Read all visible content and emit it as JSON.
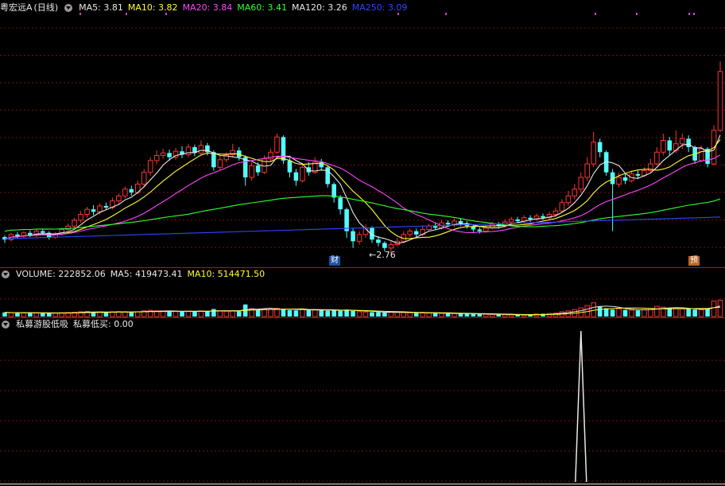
{
  "price_panel": {
    "stock_name": "粤宏远A",
    "period": "(日线)",
    "ma5": "MA5: 3.81",
    "ma10": "MA10: 3.82",
    "ma20": "MA20: 3.84",
    "ma60": "MA60: 3.41",
    "ma120": "MA120: 3.26",
    "ma250": "MA250: 3.09",
    "low_marker": "←2.76",
    "event_cai": "财",
    "event_yu": "预"
  },
  "volume_panel": {
    "volume": "VOLUME: 222852.06",
    "ma5": "MA5: 419473.41",
    "ma10": "MA10: 514471.50"
  },
  "indicator_panel": {
    "name": "私募游股低吸",
    "output": "私募低买: 0.00"
  },
  "colors": {
    "up": "#ff3333",
    "down": "#54fcfc",
    "ma5": "#e8e8e8",
    "ma10": "#ffff33",
    "ma20": "#ff44ff",
    "ma60": "#33ff33",
    "ma250": "#3344ff",
    "grid": "#7a1010"
  },
  "chart_data": [
    {
      "type": "candlestick",
      "title": "粤宏远A (日线)",
      "ylim": [
        2.6,
        5.6
      ],
      "low_annotation": 2.76,
      "candles": [
        [
          2.95,
          2.92,
          2.97,
          2.88
        ],
        [
          2.92,
          2.98,
          3.0,
          2.9
        ],
        [
          2.98,
          2.96,
          3.01,
          2.93
        ],
        [
          2.96,
          3.0,
          3.02,
          2.94
        ],
        [
          3.0,
          2.97,
          3.03,
          2.95
        ],
        [
          2.97,
          3.02,
          3.04,
          2.95
        ],
        [
          3.02,
          3.0,
          3.05,
          2.97
        ],
        [
          3.0,
          2.95,
          3.02,
          2.92
        ],
        [
          2.95,
          2.99,
          3.01,
          2.93
        ],
        [
          2.99,
          3.04,
          3.06,
          2.97
        ],
        [
          3.04,
          3.08,
          3.11,
          3.02
        ],
        [
          3.08,
          3.15,
          3.18,
          3.06
        ],
        [
          3.15,
          3.22,
          3.26,
          3.12
        ],
        [
          3.22,
          3.28,
          3.31,
          3.18
        ],
        [
          3.28,
          3.25,
          3.33,
          3.21
        ],
        [
          3.25,
          3.32,
          3.35,
          3.22
        ],
        [
          3.32,
          3.3,
          3.36,
          3.27
        ],
        [
          3.3,
          3.38,
          3.42,
          3.28
        ],
        [
          3.38,
          3.44,
          3.47,
          3.35
        ],
        [
          3.44,
          3.52,
          3.55,
          3.41
        ],
        [
          3.52,
          3.48,
          3.56,
          3.44
        ],
        [
          3.48,
          3.58,
          3.62,
          3.46
        ],
        [
          3.58,
          3.72,
          3.76,
          3.55
        ],
        [
          3.72,
          3.86,
          3.9,
          3.68
        ],
        [
          3.86,
          3.92,
          3.98,
          3.82
        ],
        [
          3.92,
          3.95,
          4.0,
          3.88
        ],
        [
          3.95,
          3.9,
          3.99,
          3.86
        ],
        [
          3.9,
          3.97,
          4.01,
          3.87
        ],
        [
          3.97,
          3.93,
          4.03,
          3.89
        ],
        [
          3.93,
          4.02,
          4.06,
          3.9
        ],
        [
          4.02,
          3.95,
          4.05,
          3.91
        ],
        [
          3.95,
          4.04,
          4.1,
          3.93
        ],
        [
          4.04,
          3.96,
          4.07,
          3.92
        ],
        [
          3.96,
          3.78,
          3.98,
          3.74
        ],
        [
          3.78,
          3.87,
          3.92,
          3.75
        ],
        [
          3.87,
          3.93,
          3.96,
          3.84
        ],
        [
          3.93,
          3.98,
          4.06,
          3.9
        ],
        [
          3.98,
          3.9,
          4.02,
          3.86
        ],
        [
          3.9,
          3.66,
          3.92,
          3.56
        ],
        [
          3.66,
          3.8,
          3.84,
          3.62
        ],
        [
          3.8,
          3.72,
          3.84,
          3.68
        ],
        [
          3.72,
          3.88,
          3.92,
          3.7
        ],
        [
          3.88,
          3.96,
          4.0,
          3.85
        ],
        [
          3.96,
          4.14,
          4.18,
          3.94
        ],
        [
          4.14,
          3.86,
          4.16,
          3.82
        ],
        [
          3.86,
          3.72,
          3.9,
          3.66
        ],
        [
          3.72,
          3.62,
          3.76,
          3.56
        ],
        [
          3.62,
          3.78,
          3.82,
          3.6
        ],
        [
          3.78,
          3.72,
          3.84,
          3.68
        ],
        [
          3.72,
          3.84,
          3.9,
          3.7
        ],
        [
          3.84,
          3.78,
          3.88,
          3.74
        ],
        [
          3.78,
          3.58,
          3.8,
          3.54
        ],
        [
          3.58,
          3.42,
          3.6,
          3.36
        ],
        [
          3.42,
          3.28,
          3.45,
          3.22
        ],
        [
          3.28,
          3.02,
          3.3,
          2.94
        ],
        [
          3.02,
          2.9,
          3.06,
          2.82
        ],
        [
          2.9,
          2.98,
          3.02,
          2.86
        ],
        [
          2.98,
          3.06,
          3.1,
          2.94
        ],
        [
          3.06,
          2.92,
          3.08,
          2.88
        ],
        [
          2.92,
          2.88,
          2.96,
          2.84
        ],
        [
          2.88,
          2.82,
          2.9,
          2.78
        ],
        [
          2.82,
          2.86,
          2.9,
          2.76
        ],
        [
          2.86,
          2.9,
          2.94,
          2.84
        ],
        [
          2.9,
          2.98,
          3.02,
          2.88
        ],
        [
          2.98,
          3.02,
          3.05,
          2.95
        ],
        [
          3.02,
          2.98,
          3.05,
          2.95
        ],
        [
          2.98,
          3.04,
          3.08,
          2.96
        ],
        [
          3.04,
          3.08,
          3.11,
          3.02
        ],
        [
          3.08,
          3.06,
          3.12,
          3.03
        ],
        [
          3.06,
          3.12,
          3.15,
          3.04
        ],
        [
          3.12,
          3.1,
          3.15,
          3.07
        ],
        [
          3.1,
          3.14,
          3.17,
          3.07
        ],
        [
          3.14,
          3.11,
          3.17,
          3.08
        ],
        [
          3.11,
          3.08,
          3.14,
          3.05
        ],
        [
          3.08,
          3.04,
          3.1,
          3.01
        ],
        [
          3.04,
          3.02,
          3.07,
          2.99
        ],
        [
          3.02,
          3.06,
          3.09,
          3.0
        ],
        [
          3.06,
          3.1,
          3.13,
          3.04
        ],
        [
          3.1,
          3.08,
          3.13,
          3.05
        ],
        [
          3.08,
          3.13,
          3.16,
          3.06
        ],
        [
          3.13,
          3.16,
          3.19,
          3.1
        ],
        [
          3.16,
          3.14,
          3.19,
          3.11
        ],
        [
          3.14,
          3.18,
          3.21,
          3.12
        ],
        [
          3.18,
          3.16,
          3.21,
          3.13
        ],
        [
          3.16,
          3.2,
          3.23,
          3.14
        ],
        [
          3.2,
          3.18,
          3.23,
          3.15
        ],
        [
          3.18,
          3.22,
          3.25,
          3.16
        ],
        [
          3.22,
          3.26,
          3.3,
          3.19
        ],
        [
          3.26,
          3.36,
          3.4,
          3.24
        ],
        [
          3.36,
          3.44,
          3.5,
          3.32
        ],
        [
          3.44,
          3.52,
          3.58,
          3.4
        ],
        [
          3.52,
          3.66,
          3.72,
          3.48
        ],
        [
          3.66,
          3.82,
          3.9,
          3.62
        ],
        [
          3.82,
          4.08,
          4.2,
          3.78
        ],
        [
          4.08,
          3.96,
          4.12,
          3.9
        ],
        [
          3.96,
          3.72,
          3.98,
          3.68
        ],
        [
          3.72,
          3.58,
          3.76,
          3.02
        ],
        [
          3.58,
          3.66,
          3.72,
          3.54
        ],
        [
          3.66,
          3.62,
          3.7,
          3.58
        ],
        [
          3.62,
          3.7,
          3.74,
          3.6
        ],
        [
          3.7,
          3.68,
          3.74,
          3.64
        ],
        [
          3.68,
          3.74,
          3.78,
          3.66
        ],
        [
          3.74,
          3.82,
          3.88,
          3.72
        ],
        [
          3.82,
          3.96,
          4.02,
          3.8
        ],
        [
          3.96,
          4.1,
          4.18,
          3.92
        ],
        [
          4.1,
          3.98,
          4.14,
          3.92
        ],
        [
          3.98,
          4.06,
          4.22,
          3.95
        ],
        [
          4.06,
          4.12,
          4.18,
          4.0
        ],
        [
          4.12,
          4.02,
          4.16,
          3.96
        ],
        [
          4.02,
          3.86,
          4.04,
          3.82
        ],
        [
          3.86,
          4.0,
          4.04,
          3.84
        ],
        [
          4.0,
          3.82,
          4.02,
          3.78
        ],
        [
          3.82,
          4.22,
          4.28,
          3.8
        ],
        [
          4.22,
          4.92,
          5.04,
          4.2
        ]
      ]
    },
    {
      "type": "bar",
      "title": "VOLUME",
      "values": [
        310,
        280,
        300,
        260,
        290,
        270,
        250,
        240,
        260,
        280,
        300,
        320,
        360,
        380,
        340,
        330,
        310,
        350,
        370,
        360,
        330,
        360,
        430,
        470,
        420,
        400,
        380,
        390,
        370,
        400,
        380,
        420,
        380,
        560,
        430,
        400,
        410,
        380,
        900,
        600,
        500,
        560,
        540,
        620,
        560,
        480,
        460,
        520,
        480,
        520,
        470,
        440,
        460,
        430,
        520,
        420,
        360,
        340,
        330,
        320,
        300,
        320,
        310,
        300,
        290,
        280,
        270,
        260,
        250,
        240,
        230,
        220,
        210,
        200,
        190,
        180,
        170,
        160,
        150,
        140,
        130,
        120,
        110,
        100,
        190,
        210,
        230,
        260,
        360,
        420,
        520,
        640,
        820,
        1020,
        760,
        620,
        520,
        580,
        500,
        480,
        460,
        520,
        600,
        760,
        700,
        640,
        600,
        580,
        560,
        520,
        500,
        560,
        1160,
        1220
      ],
      "ylim": [
        0,
        2600
      ]
    },
    {
      "type": "line",
      "title": "私募游股低吸",
      "series": [
        {
          "name": "私募低买",
          "spike_index": 91,
          "spike_value": 1,
          "baseline": 0
        }
      ],
      "ylim": [
        0,
        1
      ]
    }
  ]
}
